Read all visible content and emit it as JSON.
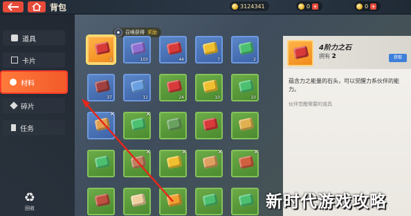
{
  "header": {
    "title": "背包",
    "currencies": [
      {
        "icon": "gold-coin-icon",
        "amount": "3124341"
      },
      {
        "icon": "gold-coin-icon",
        "amount": "0"
      },
      {
        "icon": "gold-coin-icon",
        "amount": "0"
      }
    ]
  },
  "sidebar": {
    "items": [
      {
        "label": "道具",
        "icon": "bag-icon"
      },
      {
        "label": "卡片",
        "icon": "card-icon"
      },
      {
        "label": "材料",
        "icon": "material-icon",
        "active": true
      },
      {
        "label": "碎片",
        "icon": "fragment-icon"
      },
      {
        "label": "任务",
        "icon": "task-icon"
      }
    ],
    "recycle_label": "回收"
  },
  "tip": {
    "prefix": "召唤获得",
    "highlight": "奖励"
  },
  "grid": {
    "slots": [
      {
        "rarity": "orange",
        "color": "#d83a3a",
        "count": "2",
        "selected": true
      },
      {
        "rarity": "blue",
        "color": "#8f6fd0",
        "count": "103"
      },
      {
        "rarity": "blue",
        "color": "#d83a3a",
        "count": "44"
      },
      {
        "rarity": "blue",
        "color": "#f0c030",
        "count": "7"
      },
      {
        "rarity": "blue",
        "color": "#4cc070",
        "count": "2"
      },
      {
        "rarity": "blue",
        "color": "#a04040",
        "count": "37"
      },
      {
        "rarity": "blue",
        "color": "#6aa0e0",
        "count": "11"
      },
      {
        "rarity": "green",
        "color": "#d83a3a",
        "count": "24"
      },
      {
        "rarity": "green",
        "color": "#f0c030",
        "count": "10"
      },
      {
        "rarity": "green",
        "color": "#4cc070",
        "count": "10"
      },
      {
        "rarity": "blue",
        "color": "#e0a050",
        "count": "",
        "x": true
      },
      {
        "rarity": "green",
        "color": "#4cc070",
        "count": "",
        "x": true
      },
      {
        "rarity": "green",
        "color": "#6aa060",
        "count": ""
      },
      {
        "rarity": "green",
        "color": "#d83a3a",
        "count": ""
      },
      {
        "rarity": "green",
        "color": "#e0b050",
        "count": ""
      },
      {
        "rarity": "green",
        "color": "#4cc070",
        "count": ""
      },
      {
        "rarity": "green",
        "color": "#c08060",
        "count": "",
        "x": true
      },
      {
        "rarity": "green",
        "color": "#f0c030",
        "count": "",
        "x": true
      },
      {
        "rarity": "green",
        "color": "#e0a060",
        "count": "",
        "x": true
      },
      {
        "rarity": "green",
        "color": "#d06040",
        "count": "",
        "x": true
      },
      {
        "rarity": "green",
        "color": "#c05040",
        "count": ""
      },
      {
        "rarity": "green",
        "color": "#f0d0a0",
        "count": ""
      },
      {
        "rarity": "green",
        "color": "#f0a030",
        "count": ""
      },
      {
        "rarity": "green",
        "color": "#4cc070",
        "count": ""
      },
      {
        "rarity": "green",
        "color": "#4cc070",
        "count": ""
      }
    ]
  },
  "detail": {
    "name": "4阶力之石",
    "own_label": "拥有",
    "own_count": "2",
    "button_label": "获取",
    "description": "蕴含力之能量的石头，可以觉醒力系伙伴的能力。",
    "use_text": "伙伴觉醒需要的道具"
  },
  "watermark": "新时代游戏攻略"
}
